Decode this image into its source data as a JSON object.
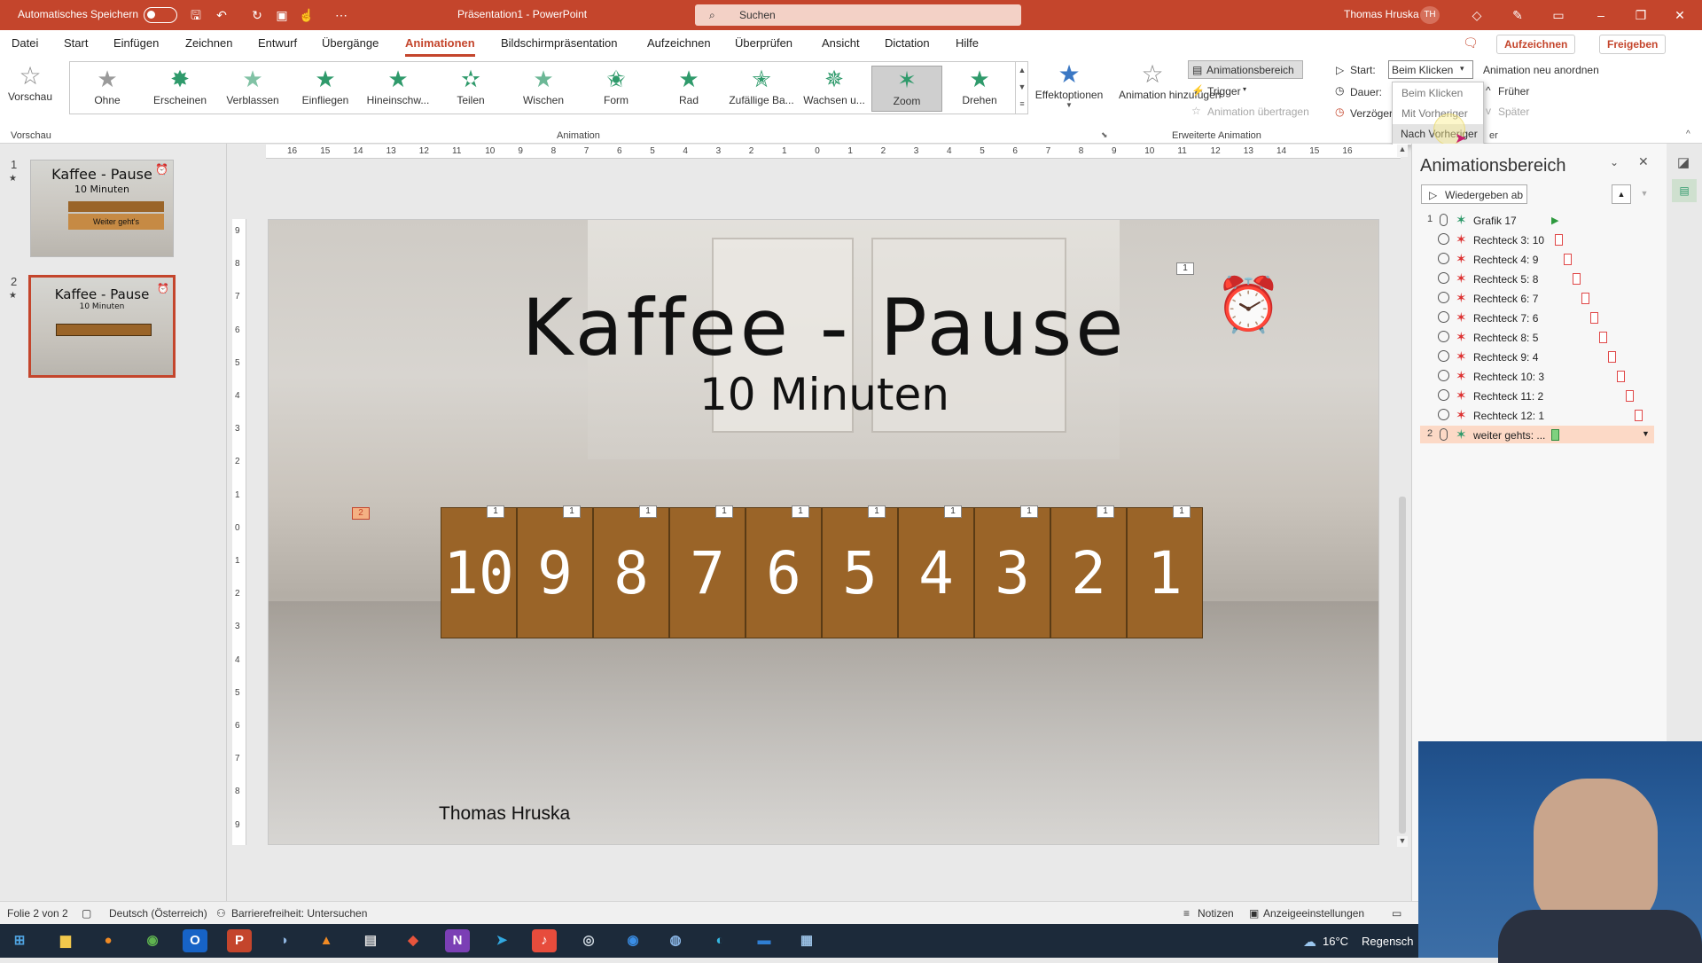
{
  "titlebar": {
    "autosave": "Automatisches Speichern",
    "doc_title": "Präsentation1 - PowerPoint",
    "search_placeholder": "Suchen",
    "user": "Thomas Hruska",
    "initials": "TH"
  },
  "menu": {
    "tabs": [
      "Datei",
      "Start",
      "Einfügen",
      "Zeichnen",
      "Entwurf",
      "Übergänge",
      "Animationen",
      "Bildschirmpräsentation",
      "Aufzeichnen",
      "Überprüfen",
      "Ansicht",
      "Dictation",
      "Hilfe"
    ],
    "record": "Aufzeichnen",
    "share": "Freigeben"
  },
  "ribbon": {
    "preview": "Vorschau",
    "preview_group": "Vorschau",
    "animations": [
      "Ohne",
      "Erscheinen",
      "Verblassen",
      "Einfliegen",
      "Hineinschw...",
      "Teilen",
      "Wischen",
      "Form",
      "Rad",
      "Zufällige Ba...",
      "Wachsen u...",
      "Zoom",
      "Drehen"
    ],
    "selected_animation": "Zoom",
    "effect_options": "Effektoptionen",
    "animation_group": "Animation",
    "add_animation": "Animation hinzufügen",
    "anim_pane": "Animationsbereich",
    "trigger": "Trigger",
    "anim_painter": "Animation übertragen",
    "advanced_group": "Erweiterte Animation",
    "start_label": "Start:",
    "start_value": "Beim Klicken",
    "duration_label": "Dauer:",
    "delay_label": "Verzöger",
    "dropdown": [
      "Beim Klicken",
      "Mit Vorheriger",
      "Nach Vorheriger"
    ],
    "hovered_option": "Nach Vorheriger",
    "reorder": "Animation neu anordnen",
    "earlier": "Früher",
    "later": "Später",
    "timing_group_partial": "er"
  },
  "thumbnails": [
    {
      "num": "1",
      "title": "Kaffee - Pause",
      "sub": "10 Minuten",
      "extra": "Weiter geht's"
    },
    {
      "num": "2",
      "title": "Kaffee - Pause",
      "sub": "10 Minuten"
    }
  ],
  "ruler": {
    "h": [
      "16",
      "15",
      "14",
      "13",
      "12",
      "11",
      "10",
      "9",
      "8",
      "7",
      "6",
      "5",
      "4",
      "3",
      "2",
      "1",
      "0",
      "1",
      "2",
      "3",
      "4",
      "5",
      "6",
      "7",
      "8",
      "9",
      "10",
      "11",
      "12",
      "13",
      "14",
      "15",
      "16"
    ],
    "v": [
      "9",
      "8",
      "7",
      "6",
      "5",
      "4",
      "3",
      "2",
      "1",
      "0",
      "1",
      "2",
      "3",
      "4",
      "5",
      "6",
      "7",
      "8",
      "9"
    ]
  },
  "slide": {
    "title": "Kaffee - Pause",
    "subtitle": "10 Minuten",
    "author": "Thomas Hruska",
    "countdown": [
      "10",
      "9",
      "8",
      "7",
      "6",
      "5",
      "4",
      "3",
      "2",
      "1"
    ],
    "tag_one": "1",
    "tag_two": "2",
    "tag_alarm": "1"
  },
  "pane": {
    "title": "Animationsbereich",
    "play_from": "Wiedergeben ab",
    "items": [
      {
        "num": "1",
        "label": "Grafik 17",
        "kind": "green"
      },
      {
        "num": "",
        "label": "Rechteck 3: 10"
      },
      {
        "num": "",
        "label": "Rechteck 4: 9"
      },
      {
        "num": "",
        "label": "Rechteck 5: 8"
      },
      {
        "num": "",
        "label": "Rechteck 6: 7"
      },
      {
        "num": "",
        "label": "Rechteck 7: 6"
      },
      {
        "num": "",
        "label": "Rechteck 8: 5"
      },
      {
        "num": "",
        "label": "Rechteck 9: 4"
      },
      {
        "num": "",
        "label": "Rechteck 10: 3"
      },
      {
        "num": "",
        "label": "Rechteck 11: 2"
      },
      {
        "num": "",
        "label": "Rechteck 12: 1"
      },
      {
        "num": "2",
        "label": "weiter gehts: ...",
        "kind": "sel"
      }
    ]
  },
  "status": {
    "slide": "Folie 2 von 2",
    "lang": "Deutsch (Österreich)",
    "access": "Barrierefreiheit: Untersuchen",
    "notes": "Notizen",
    "display": "Anzeigeeinstellungen"
  },
  "taskbar": {
    "weather": "16°C",
    "weather_text": "Regensch"
  },
  "colors": {
    "accent": "#c4452c",
    "tile": "#9a6428",
    "green": "#2f9a6b"
  }
}
